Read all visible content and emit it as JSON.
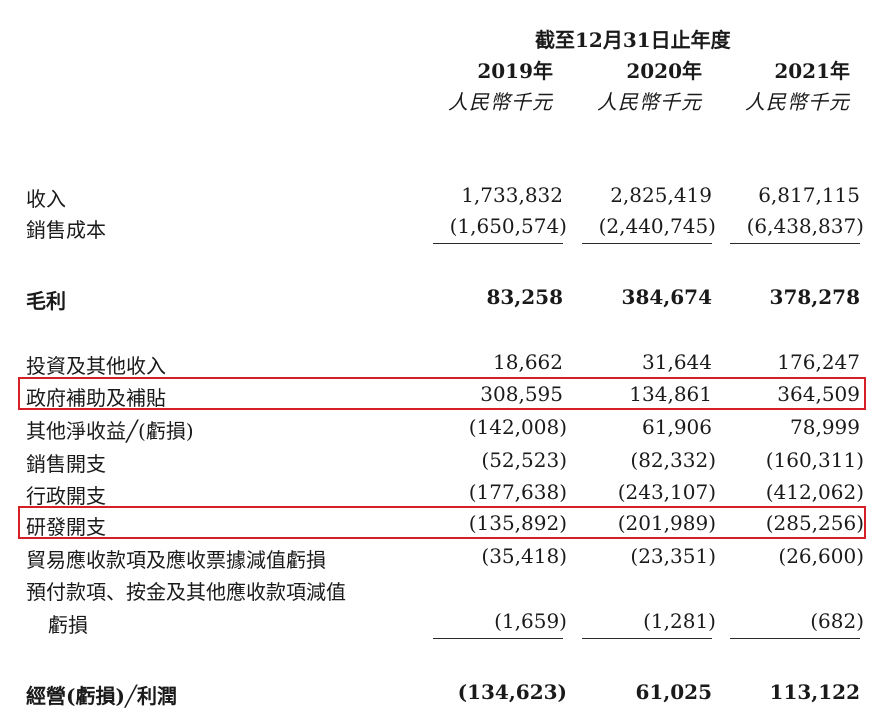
{
  "header": {
    "period": "截至12月31日止年度",
    "years": [
      "2019年",
      "2020年",
      "2021年"
    ],
    "unit": "人民幣千元"
  },
  "rows": [
    {
      "label": "收入",
      "values": [
        "1,733,832",
        "2,825,419",
        "6,817,115"
      ]
    },
    {
      "label": "銷售成本",
      "values": [
        "(1,650,574)",
        "(2,440,745)",
        "(6,438,837)"
      ]
    },
    {
      "label": "毛利",
      "values": [
        "83,258",
        "384,674",
        "378,278"
      ]
    },
    {
      "label": "投資及其他收入",
      "values": [
        "18,662",
        "31,644",
        "176,247"
      ]
    },
    {
      "label": "政府補助及補貼",
      "values": [
        "308,595",
        "134,861",
        "364,509"
      ]
    },
    {
      "label": "其他淨收益╱(虧損)",
      "values": [
        "(142,008)",
        "61,906",
        "78,999"
      ]
    },
    {
      "label": "銷售開支",
      "values": [
        "(52,523)",
        "(82,332)",
        "(160,311)"
      ]
    },
    {
      "label": "行政開支",
      "values": [
        "(177,638)",
        "(243,107)",
        "(412,062)"
      ]
    },
    {
      "label": "研發開支",
      "values": [
        "(135,892)",
        "(201,989)",
        "(285,256)"
      ]
    },
    {
      "label": "貿易應收款項及應收票據減值虧損",
      "values": [
        "(35,418)",
        "(23,351)",
        "(26,600)"
      ]
    },
    {
      "label": "預付款項、按金及其他應收款項減值",
      "label_cont": "虧損",
      "values": [
        "(1,659)",
        "(1,281)",
        "(682)"
      ]
    },
    {
      "label": "經營(虧損)╱利潤",
      "values": [
        "(134,623)",
        "61,025",
        "113,122"
      ]
    }
  ],
  "highlight_color": "#d62027"
}
